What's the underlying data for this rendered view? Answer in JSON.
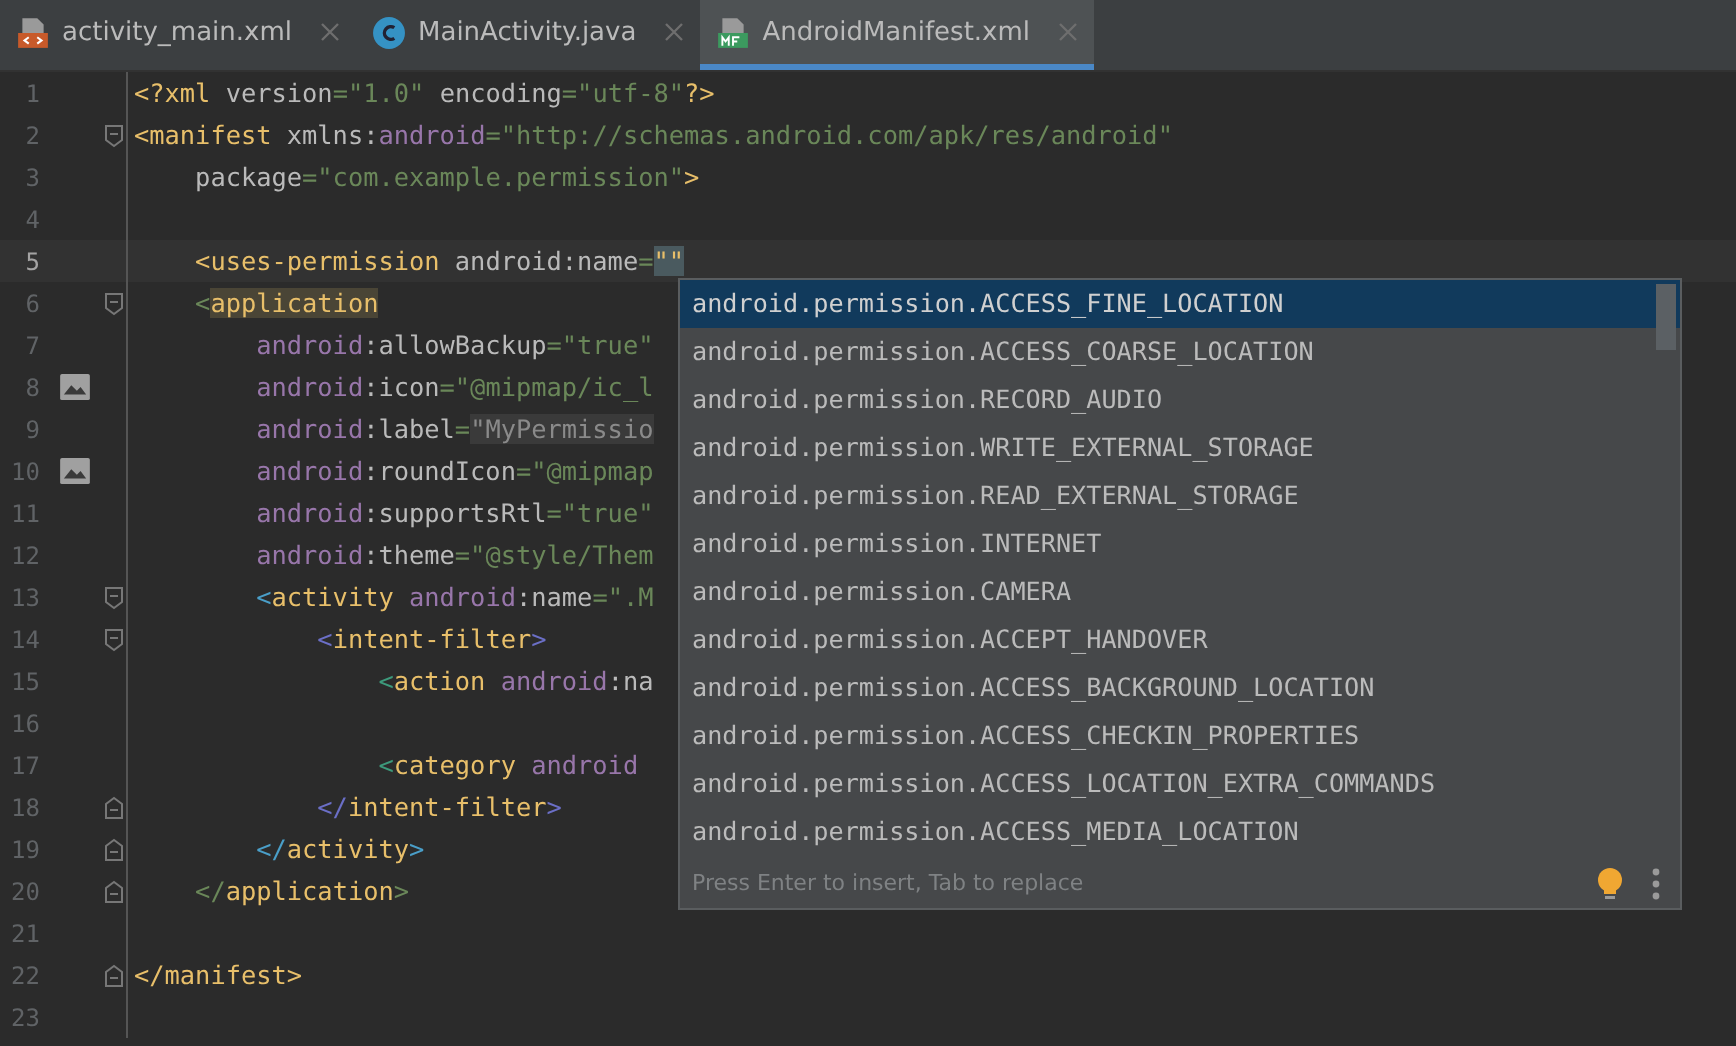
{
  "tabs": [
    {
      "label": "activity_main.xml",
      "kind": "layout",
      "selected": false
    },
    {
      "label": "MainActivity.java",
      "kind": "class",
      "selected": false
    },
    {
      "label": "AndroidManifest.xml",
      "kind": "manifest",
      "selected": true
    }
  ],
  "editor": {
    "lines": [
      {
        "number": "1",
        "tokens": [
          {
            "kind": "tag",
            "text": "<?xml "
          },
          {
            "kind": "attr",
            "text": "version"
          },
          {
            "kind": "value",
            "text": "=\"1.0\" "
          },
          {
            "kind": "attr",
            "text": "encoding"
          },
          {
            "kind": "value",
            "text": "=\"utf-8\""
          },
          {
            "kind": "tag",
            "text": "?>"
          }
        ]
      },
      {
        "number": "2",
        "fold_start": true,
        "tokens": [
          {
            "kind": "tag",
            "text": "<manifest "
          },
          {
            "kind": "attr",
            "text": "xmlns:"
          },
          {
            "kind": "ns",
            "text": "android"
          },
          {
            "kind": "value",
            "text": "=\"http://schemas.android.com/apk/res/android\""
          }
        ]
      },
      {
        "number": "3",
        "tokens": [
          {
            "kind": "attr",
            "text": "    package"
          },
          {
            "kind": "value",
            "text": "=\"com.example.permission\""
          },
          {
            "kind": "tag",
            "text": ">"
          }
        ]
      },
      {
        "number": "4"
      },
      {
        "number": "5",
        "current": true,
        "tokens": [
          {
            "kind": "tag",
            "text": "    <uses-permission "
          },
          {
            "kind": "attr",
            "text": "android:name"
          },
          {
            "kind": "value",
            "text": "="
          },
          {
            "kind": "caret",
            "text": "\"\""
          }
        ]
      },
      {
        "number": "6",
        "fold_start": true,
        "tokens": [
          {
            "kind": "bracket",
            "text": "    <",
            "color": "#6a8759"
          },
          {
            "kind": "match",
            "text": "application"
          }
        ]
      },
      {
        "number": "7",
        "tokens": [
          {
            "kind": "ns",
            "text": "        android"
          },
          {
            "kind": "attr",
            "text": ":allowBackup"
          },
          {
            "kind": "value",
            "text": "=\"true\""
          }
        ]
      },
      {
        "number": "8",
        "gutter_image": true,
        "tokens": [
          {
            "kind": "ns",
            "text": "        android"
          },
          {
            "kind": "attr",
            "text": ":icon"
          },
          {
            "kind": "value",
            "text": "=\"@mipmap/ic_l"
          }
        ]
      },
      {
        "number": "9",
        "tokens": [
          {
            "kind": "ns",
            "text": "        android"
          },
          {
            "kind": "attr",
            "text": ":label"
          },
          {
            "kind": "value",
            "text": "="
          },
          {
            "kind": "folded",
            "text": "\"MyPermissio"
          }
        ]
      },
      {
        "number": "10",
        "gutter_image": true,
        "tokens": [
          {
            "kind": "ns",
            "text": "        android"
          },
          {
            "kind": "attr",
            "text": ":roundIcon"
          },
          {
            "kind": "value",
            "text": "=\"@mipmap"
          }
        ]
      },
      {
        "number": "11",
        "tokens": [
          {
            "kind": "ns",
            "text": "        android"
          },
          {
            "kind": "attr",
            "text": ":supportsRtl"
          },
          {
            "kind": "value",
            "text": "=\"true\""
          }
        ]
      },
      {
        "number": "12",
        "tokens": [
          {
            "kind": "ns",
            "text": "        android"
          },
          {
            "kind": "attr",
            "text": ":theme"
          },
          {
            "kind": "value",
            "text": "=\"@style/Them"
          }
        ]
      },
      {
        "number": "13",
        "fold_start": true,
        "tokens": [
          {
            "kind": "bracket",
            "text": "        <",
            "color": "#4a9fc9"
          },
          {
            "kind": "tag",
            "text": "activity "
          },
          {
            "kind": "ns",
            "text": "android"
          },
          {
            "kind": "attr",
            "text": ":name"
          },
          {
            "kind": "value",
            "text": "=\".M"
          }
        ]
      },
      {
        "number": "14",
        "fold_start": true,
        "tokens": [
          {
            "kind": "bracket",
            "text": "            <",
            "color": "#6b6fc7"
          },
          {
            "kind": "tag",
            "text": "intent-filter"
          },
          {
            "kind": "bracket",
            "text": ">",
            "color": "#6b6fc7"
          }
        ]
      },
      {
        "number": "15",
        "tokens": [
          {
            "kind": "bracket",
            "text": "                <",
            "color": "#3d9a7c"
          },
          {
            "kind": "tag",
            "text": "action "
          },
          {
            "kind": "ns",
            "text": "android"
          },
          {
            "kind": "attr",
            "text": ":na"
          }
        ]
      },
      {
        "number": "16"
      },
      {
        "number": "17",
        "tokens": [
          {
            "kind": "bracket",
            "text": "                <",
            "color": "#3d9a7c"
          },
          {
            "kind": "tag",
            "text": "category "
          },
          {
            "kind": "ns",
            "text": "android"
          }
        ]
      },
      {
        "number": "18",
        "fold_end": true,
        "tokens": [
          {
            "kind": "bracket",
            "text": "            </",
            "color": "#6b6fc7"
          },
          {
            "kind": "tag",
            "text": "intent-filter"
          },
          {
            "kind": "bracket",
            "text": ">",
            "color": "#6b6fc7"
          }
        ]
      },
      {
        "number": "19",
        "fold_end": true,
        "tokens": [
          {
            "kind": "bracket",
            "text": "        </",
            "color": "#4a9fc9"
          },
          {
            "kind": "tag",
            "text": "activity"
          },
          {
            "kind": "bracket",
            "text": ">",
            "color": "#4a9fc9"
          }
        ]
      },
      {
        "number": "20",
        "fold_end": true,
        "tokens": [
          {
            "kind": "bracket",
            "text": "    </",
            "color": "#6a8759"
          },
          {
            "kind": "tag",
            "text": "application"
          },
          {
            "kind": "bracket",
            "text": ">",
            "color": "#6a8759"
          }
        ]
      },
      {
        "number": "21"
      },
      {
        "number": "22",
        "fold_end": true,
        "tokens": [
          {
            "kind": "tag",
            "text": "</manifest>"
          }
        ]
      },
      {
        "number": "23"
      }
    ]
  },
  "completion": {
    "items": [
      {
        "label": "android.permission.ACCESS_FINE_LOCATION",
        "selected": true
      },
      {
        "label": "android.permission.ACCESS_COARSE_LOCATION",
        "selected": false
      },
      {
        "label": "android.permission.RECORD_AUDIO",
        "selected": false
      },
      {
        "label": "android.permission.WRITE_EXTERNAL_STORAGE",
        "selected": false
      },
      {
        "label": "android.permission.READ_EXTERNAL_STORAGE",
        "selected": false
      },
      {
        "label": "android.permission.INTERNET",
        "selected": false
      },
      {
        "label": "android.permission.CAMERA",
        "selected": false
      },
      {
        "label": "android.permission.ACCEPT_HANDOVER",
        "selected": false
      },
      {
        "label": "android.permission.ACCESS_BACKGROUND_LOCATION",
        "selected": false
      },
      {
        "label": "android.permission.ACCESS_CHECKIN_PROPERTIES",
        "selected": false
      },
      {
        "label": "android.permission.ACCESS_LOCATION_EXTRA_COMMANDS",
        "selected": false
      },
      {
        "label": "android.permission.ACCESS_MEDIA_LOCATION",
        "selected": false
      }
    ],
    "hint": "Press Enter to insert, Tab to replace"
  }
}
